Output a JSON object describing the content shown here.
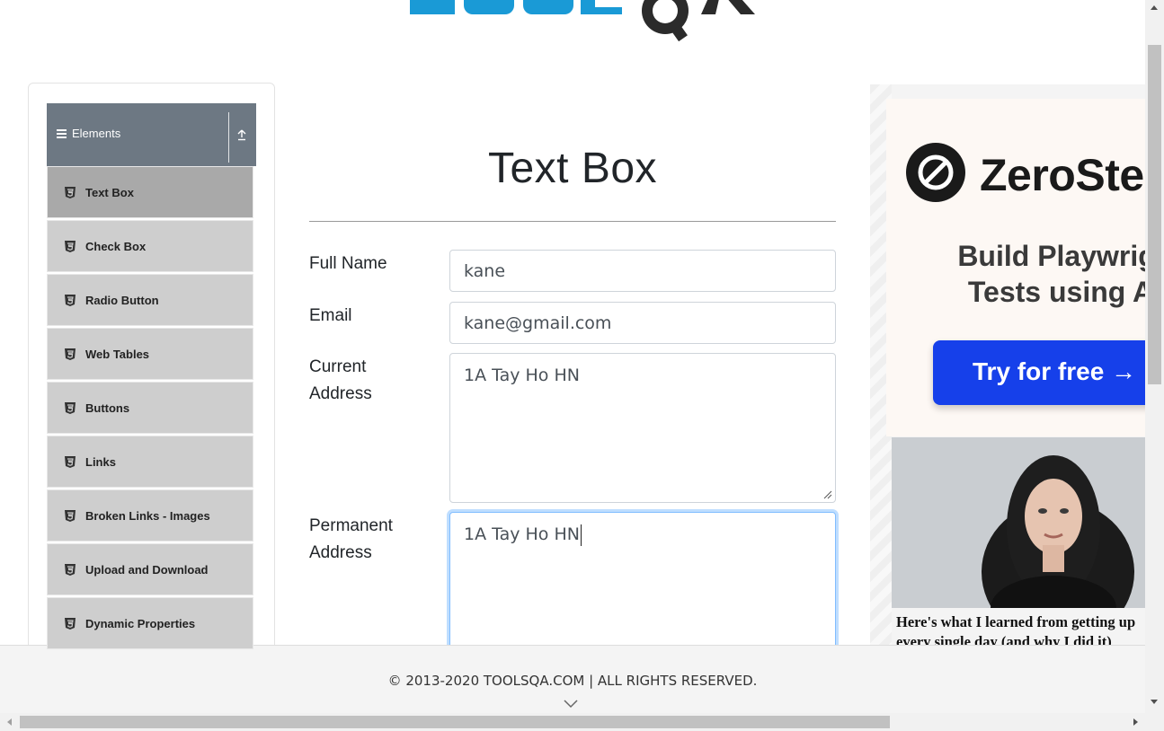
{
  "brand_colors": {
    "menu_header": "#6d7883",
    "menu_item": "#cecece",
    "menu_item_active": "#a9a9a9",
    "focus_ring": "#80bdff",
    "ad_cta": "#1640ea"
  },
  "sidebar": {
    "group_title": "Elements",
    "items": [
      {
        "label": "Text Box",
        "icon": "html5-shield-icon",
        "active": true
      },
      {
        "label": "Check Box",
        "icon": "html5-shield-icon"
      },
      {
        "label": "Radio Button",
        "icon": "html5-shield-icon"
      },
      {
        "label": "Web Tables",
        "icon": "html5-shield-icon"
      },
      {
        "label": "Buttons",
        "icon": "html5-shield-icon"
      },
      {
        "label": "Links",
        "icon": "html5-shield-icon"
      },
      {
        "label": "Broken Links - Images",
        "icon": "html5-shield-icon"
      },
      {
        "label": "Upload and Download",
        "icon": "html5-shield-icon"
      },
      {
        "label": "Dynamic Properties",
        "icon": "html5-shield-icon"
      }
    ]
  },
  "main": {
    "title": "Text Box",
    "form": {
      "full_name": {
        "label": "Full Name",
        "value": "kane"
      },
      "email": {
        "label": "Email",
        "value": "kane@gmail.com"
      },
      "current_address": {
        "label_line1": "Current",
        "label_line2": "Address",
        "value": "1A Tay Ho HN"
      },
      "permanent_address": {
        "label_line1": "Permanent",
        "label_line2": "Address",
        "value": "1A Tay Ho HN"
      }
    }
  },
  "ad": {
    "brand": "ZeroSte",
    "headline": "Build Playwrigl\nTests using A",
    "cta": "Try for free →",
    "caption": "Here's what I learned from getting up every single day (and why I did it)"
  },
  "footer": {
    "text": "© 2013-2020 TOOLSQA.COM | ALL RIGHTS RESERVED."
  }
}
